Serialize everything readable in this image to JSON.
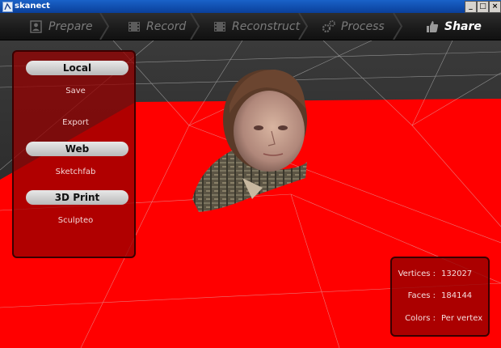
{
  "window": {
    "title": "skanect",
    "minimize": "_",
    "maximize": "□",
    "close": "×"
  },
  "nav": {
    "items": [
      {
        "label": "Prepare",
        "icon": "person-sheet-icon"
      },
      {
        "label": "Record",
        "icon": "film-icon"
      },
      {
        "label": "Reconstruct",
        "icon": "film-icon"
      },
      {
        "label": "Process",
        "icon": "gears-icon"
      },
      {
        "label": "Share",
        "icon": "thumbs-up-icon"
      }
    ],
    "active": "Share"
  },
  "share_panel": {
    "local_label": "Local",
    "save_label": "Save",
    "export_label": "Export",
    "web_label": "Web",
    "sketchfab_label": "Sketchfab",
    "print_label": "3D Print",
    "sculpteo_label": "Sculpteo"
  },
  "stats": {
    "vertices_label": "Vertices :",
    "vertices_value": "132027",
    "faces_label": "Faces :",
    "faces_value": "184144",
    "colors_label": "Colors :",
    "colors_value": "Per vertex"
  },
  "colors": {
    "floor": "#ff0000",
    "panel": "#960000",
    "nav_active": "#ffffff",
    "nav_inactive": "#7a7a7a"
  }
}
